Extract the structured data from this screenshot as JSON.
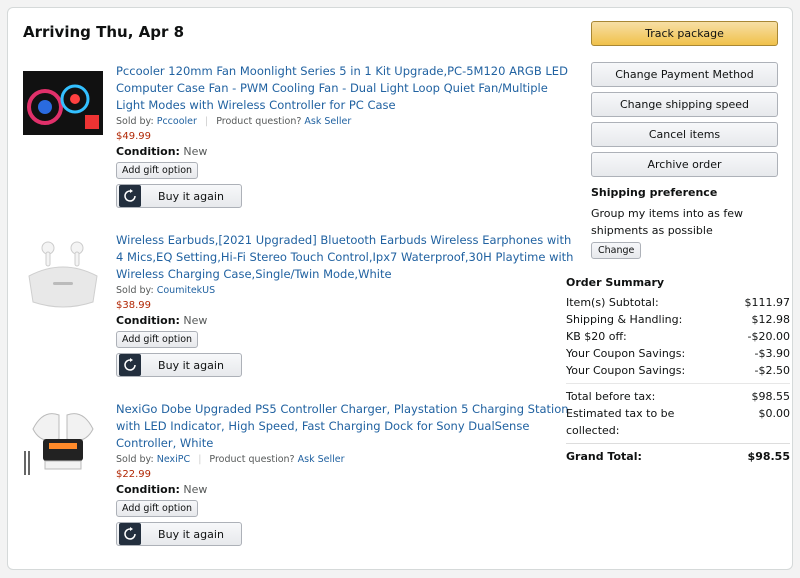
{
  "arrival": "Arriving Thu, Apr 8",
  "items": [
    {
      "title": "Pccooler 120mm Fan Moonlight Series 5 in 1 Kit Upgrade,PC-5M120 ARGB LED Computer Case Fan - PWM Cooling Fan - Dual Light Loop Quiet Fan/Multiple Light Modes with Wireless Controller for PC Case",
      "sold_by_label": "Sold by:",
      "seller": "Pccooler",
      "question": "Product question?",
      "ask": "Ask Seller",
      "price": "$49.99",
      "condition_label": "Condition:",
      "condition": "New",
      "gift": "Add gift option",
      "buy_again": "Buy it again"
    },
    {
      "title": "Wireless Earbuds,[2021 Upgraded] Bluetooth Earbuds Wireless Earphones with 4 Mics,EQ Setting,Hi-Fi Stereo Touch Control,Ipx7 Waterproof,30H Playtime with Wireless Charging Case,Single/Twin Mode,White",
      "sold_by_label": "Sold by:",
      "seller": "CoumitekUS",
      "price": "$38.99",
      "condition_label": "Condition:",
      "condition": "New",
      "gift": "Add gift option",
      "buy_again": "Buy it again"
    },
    {
      "title": "NexiGo Dobe Upgraded PS5 Controller Charger, Playstation 5 Charging Station with LED Indicator, High Speed, Fast Charging Dock for Sony DualSense Controller, White",
      "sold_by_label": "Sold by:",
      "seller": "NexiPC",
      "question": "Product question?",
      "ask": "Ask Seller",
      "price": "$22.99",
      "condition_label": "Condition:",
      "condition": "New",
      "gift": "Add gift option",
      "buy_again": "Buy it again"
    }
  ],
  "actions": {
    "track": "Track package",
    "payment": "Change Payment Method",
    "shipping_speed": "Change shipping speed",
    "cancel": "Cancel items",
    "archive": "Archive order"
  },
  "shipping_pref": {
    "title": "Shipping preference",
    "text": "Group my items into as few shipments as possible",
    "button": "Change"
  },
  "summary": {
    "title": "Order Summary",
    "rows": [
      {
        "label": "Item(s) Subtotal:",
        "value": "$111.97"
      },
      {
        "label": "Shipping & Handling:",
        "value": "$12.98"
      },
      {
        "label": "KB $20 off:",
        "value": "-$20.00"
      },
      {
        "label": "Your Coupon Savings:",
        "value": "-$3.90"
      },
      {
        "label": "Your Coupon Savings:",
        "value": "-$2.50"
      }
    ],
    "before_tax_label": "Total before tax:",
    "before_tax_value": "$98.55",
    "tax_label": "Estimated tax to be collected:",
    "tax_value": "$0.00",
    "grand_label": "Grand Total:",
    "grand_value": "$98.55"
  },
  "colors": {
    "link": "#2162a1",
    "price": "#b12704",
    "primary": "#f0c14b"
  },
  "icons": [
    "buy-again-icon"
  ]
}
